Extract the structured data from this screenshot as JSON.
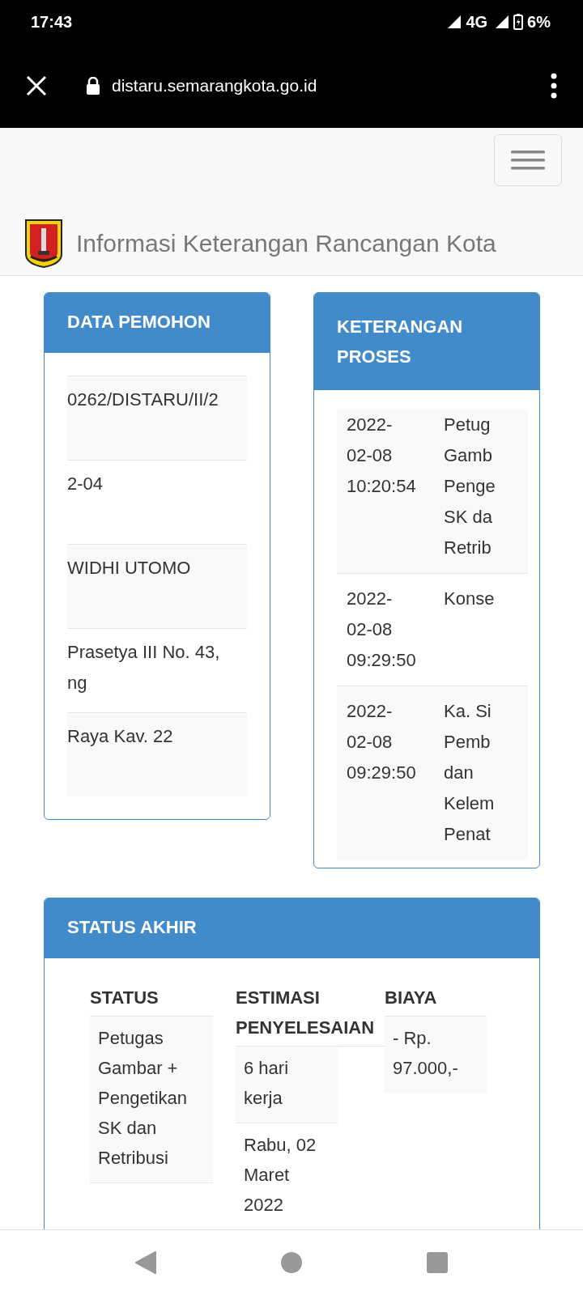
{
  "status_bar": {
    "time": "17:43",
    "network": "4G",
    "battery": "6%"
  },
  "browser": {
    "url": "distaru.semarangkota.go.id"
  },
  "site": {
    "title": "Informasi Keterangan Rancangan Kota"
  },
  "data_pemohon": {
    "title": "DATA PEMOHON",
    "rows": [
      {
        "text": "0262/DISTARU/II/2"
      },
      {
        "text": "2-04"
      },
      {
        "text": "WIDHI UTOMO"
      },
      {
        "text": "Prasetya III No. 43,\nng"
      },
      {
        "text": "Raya Kav. 22"
      }
    ]
  },
  "keterangan_proses": {
    "title": "KETERANGAN\nPROSES",
    "rows": [
      {
        "time": "2022-\n02-08\n10:20:54",
        "description": "Petug\nGamb\nPenge\nSK da\nRetrib"
      },
      {
        "time": "2022-\n02-08\n09:29:50",
        "description": "Konse"
      },
      {
        "time": "2022-\n02-08\n09:29:50",
        "description": "Ka. Si\nPemb\ndan\nKelem\nPenat"
      }
    ]
  },
  "status_akhir": {
    "title": "STATUS AKHIR",
    "columns": [
      {
        "heading": "STATUS",
        "cells": [
          "Petugas\nGambar +\nPengetikan\nSK dan\nRetribusi"
        ]
      },
      {
        "heading": "ESTIMASI\nPENYELESAIAN",
        "cells": [
          "6 hari\nkerja",
          "Rabu, 02\nMaret\n2022"
        ]
      },
      {
        "heading": "BIAYA",
        "cells": [
          "- Rp.\n97.000,-"
        ]
      }
    ]
  }
}
